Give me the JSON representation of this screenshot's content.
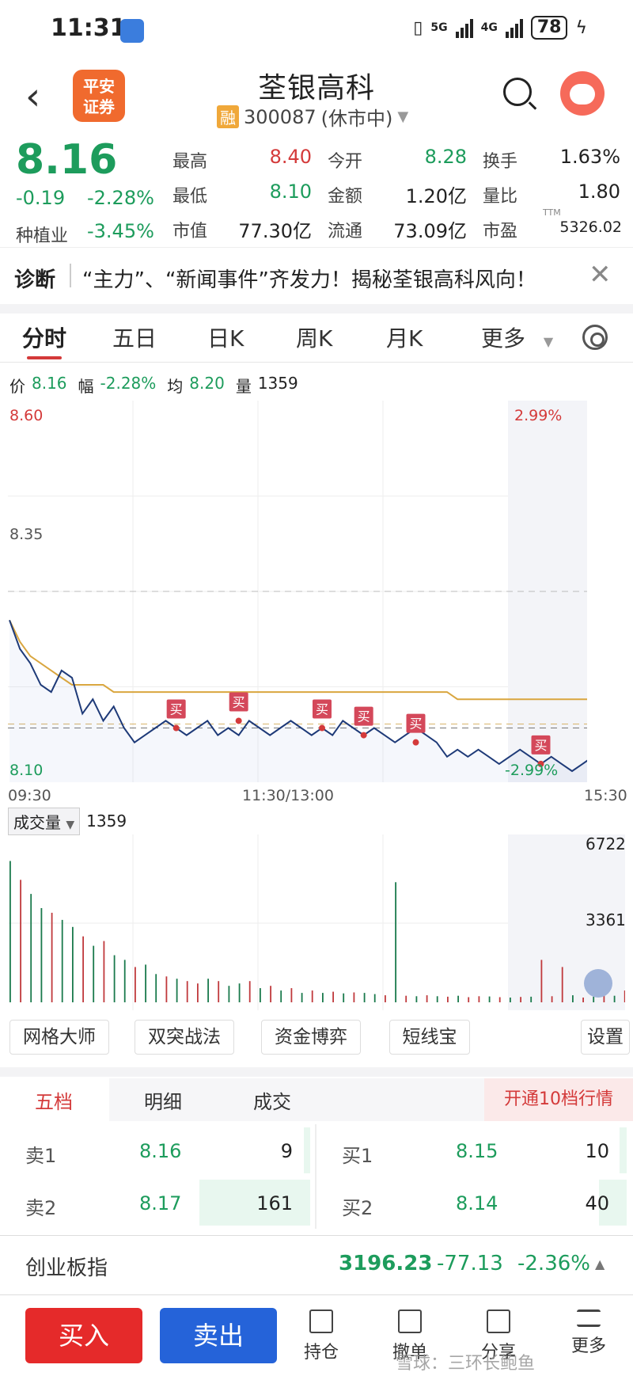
{
  "status": {
    "time": "11:31",
    "net1": "5G",
    "net2": "4G",
    "battery": "78"
  },
  "header": {
    "broker_logo": "平安\n证券",
    "broker_logo_line1": "平安",
    "broker_logo_line2": "证券",
    "title": "荃银高科",
    "margin_tag": "融",
    "code": "300087",
    "market_status": "(休市中)"
  },
  "quote": {
    "price": "8.16",
    "change": "-0.19",
    "change_pct": "-2.28%",
    "sector_name": "种植业",
    "sector_pct": "-3.45%",
    "fields": [
      {
        "label": "最高",
        "value": "8.40",
        "color": "red"
      },
      {
        "label": "最低",
        "value": "8.10",
        "color": "green"
      },
      {
        "label": "市值",
        "value": "77.30亿",
        "color": "black"
      },
      {
        "label": "今开",
        "value": "8.28",
        "color": "green"
      },
      {
        "label": "金额",
        "value": "1.20亿",
        "color": "black"
      },
      {
        "label": "流通",
        "value": "73.09亿",
        "color": "black"
      },
      {
        "label": "换手",
        "value": "1.63%",
        "color": "black"
      },
      {
        "label": "量比",
        "value": "1.80",
        "color": "black"
      },
      {
        "label": "市盈",
        "value": "5326.02",
        "color": "black",
        "superscript": "TTM"
      }
    ]
  },
  "diagnosis": {
    "tag": "诊断",
    "text": "“主力”、“新闻事件”齐发力！揭秘荃银高科风向！"
  },
  "tabs": [
    "分时",
    "五日",
    "日K",
    "周K",
    "月K",
    "更多"
  ],
  "active_tab": "分时",
  "infoline": {
    "price_label": "价",
    "price": "8.16",
    "pct_label": "幅",
    "pct": "-2.28%",
    "avg_label": "均",
    "avg": "8.20",
    "vol_label": "量",
    "vol": "1359"
  },
  "chart_data": {
    "type": "line",
    "ylim": [
      8.1,
      8.6
    ],
    "y_labels_left": [
      "8.60",
      "8.35",
      "8.10"
    ],
    "y_labels_right": [
      "2.99%",
      "-2.99%"
    ],
    "prev_close": 8.35,
    "x_ticks": [
      "09:30",
      "11:30/13:00",
      "15:30"
    ],
    "series": [
      {
        "name": "价",
        "values": [
          8.31,
          8.27,
          8.25,
          8.22,
          8.21,
          8.24,
          8.23,
          8.18,
          8.2,
          8.17,
          8.19,
          8.16,
          8.14,
          8.15,
          8.16,
          8.17,
          8.16,
          8.15,
          8.16,
          8.17,
          8.15,
          8.16,
          8.15,
          8.17,
          8.16,
          8.15,
          8.16,
          8.17,
          8.16,
          8.15,
          8.16,
          8.15,
          8.17,
          8.16,
          8.15,
          8.16,
          8.15,
          8.14,
          8.15,
          8.16,
          8.15,
          8.14,
          8.12,
          8.13,
          8.12,
          8.13,
          8.12,
          8.11,
          8.12,
          8.13,
          8.12,
          8.11,
          8.12,
          8.11,
          8.1,
          8.11,
          8.12,
          8.11,
          8.1,
          8.11,
          8.12,
          8.13,
          8.14,
          8.15,
          8.16
        ]
      },
      {
        "name": "均",
        "values": [
          8.31,
          8.28,
          8.26,
          8.25,
          8.24,
          8.23,
          8.22,
          8.22,
          8.22,
          8.22,
          8.21,
          8.21,
          8.21,
          8.21,
          8.21,
          8.21,
          8.21,
          8.21,
          8.21,
          8.21,
          8.21,
          8.21,
          8.21,
          8.21,
          8.21,
          8.21,
          8.21,
          8.21,
          8.21,
          8.21,
          8.21,
          8.21,
          8.21,
          8.21,
          8.21,
          8.21,
          8.21,
          8.21,
          8.21,
          8.21,
          8.21,
          8.21,
          8.21,
          8.2,
          8.2,
          8.2,
          8.2,
          8.2,
          8.2,
          8.2,
          8.2,
          8.2,
          8.2,
          8.2,
          8.2,
          8.2,
          8.2,
          8.2,
          8.2,
          8.2,
          8.2,
          8.2,
          8.2,
          8.2,
          8.2
        ]
      }
    ],
    "buy_markers": [
      {
        "label": "买",
        "index": 16,
        "price": 8.16
      },
      {
        "label": "买",
        "index": 22,
        "price": 8.17
      },
      {
        "label": "买",
        "index": 30,
        "price": 8.16
      },
      {
        "label": "买",
        "index": 39,
        "price": 8.14
      },
      {
        "label": "买",
        "index": 51,
        "price": 8.11
      },
      {
        "label": "买",
        "index": 34,
        "price": 8.15
      }
    ]
  },
  "volume": {
    "selector": "成交量",
    "value": "1359",
    "y_labels": [
      "6722",
      "3361"
    ],
    "ymax": 6722,
    "bars": [
      6000,
      5200,
      4600,
      4000,
      3800,
      3500,
      3200,
      2800,
      2400,
      2600,
      2000,
      1800,
      1500,
      1600,
      1200,
      1100,
      1000,
      900,
      800,
      1000,
      900,
      700,
      800,
      900,
      600,
      700,
      500,
      600,
      400,
      500,
      400,
      450,
      380,
      420,
      400,
      350,
      300,
      5100,
      280,
      260,
      300,
      260,
      240,
      280,
      220,
      260,
      250,
      220,
      200,
      230,
      240,
      1800,
      260,
      1500,
      300,
      200,
      240,
      600,
      280,
      500,
      300,
      700,
      400,
      900,
      1300
    ],
    "bar_colors": [
      "g",
      "r",
      "g",
      "g",
      "r",
      "g",
      "g",
      "r",
      "g",
      "r",
      "g",
      "g",
      "r",
      "g",
      "g",
      "r",
      "g",
      "r",
      "r",
      "g",
      "r",
      "g",
      "g",
      "r",
      "g",
      "r",
      "g",
      "r",
      "g",
      "r",
      "g",
      "r",
      "g",
      "r",
      "g",
      "g",
      "r",
      "g",
      "r",
      "g",
      "r",
      "g",
      "r",
      "g",
      "r",
      "r",
      "g",
      "r",
      "g",
      "r",
      "g",
      "r",
      "r",
      "r",
      "g",
      "r",
      "g",
      "r",
      "g",
      "r",
      "g",
      "r",
      "g",
      "r",
      "r"
    ]
  },
  "tools": [
    "网格大师",
    "双突战法",
    "资金博弈",
    "短线宝",
    "设置"
  ],
  "orderbook": {
    "tabs": [
      "五档",
      "明细",
      "成交"
    ],
    "open10": "开通10档行情",
    "sell": [
      {
        "label": "卖1",
        "price": "8.16",
        "vol": "9",
        "vol_num": 9
      },
      {
        "label": "卖2",
        "price": "8.17",
        "vol": "161",
        "vol_num": 161
      }
    ],
    "buy": [
      {
        "label": "买1",
        "price": "8.15",
        "vol": "10",
        "vol_num": 10
      },
      {
        "label": "买2",
        "price": "8.14",
        "vol": "40",
        "vol_num": 40
      }
    ]
  },
  "index": {
    "name": "创业板指",
    "value": "3196.23",
    "change": "-77.13",
    "pct": "-2.36%"
  },
  "bottom": {
    "buy": "买入",
    "sell": "卖出",
    "items": [
      "持仓",
      "撤单",
      "分享",
      "更多"
    ],
    "watermark": "雪球：三环长鲍鱼"
  }
}
